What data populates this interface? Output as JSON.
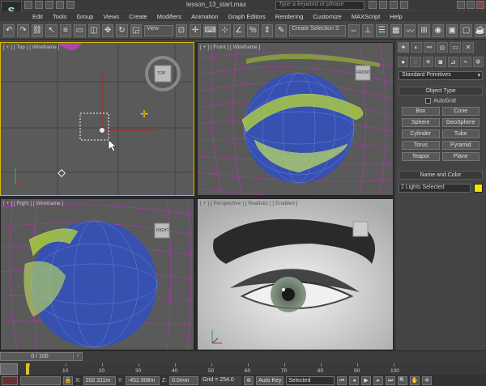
{
  "app": {
    "logo_glyph": "S",
    "document_title": "lesson_13_start.max",
    "search_placeholder": "Type a keyword or phrase"
  },
  "menu": [
    "Edit",
    "Tools",
    "Group",
    "Views",
    "Create",
    "Modifiers",
    "Animation",
    "Graph Editors",
    "Rendering",
    "Customize",
    "MAXScript",
    "Help"
  ],
  "toolbar": {
    "view_select": "View",
    "create_selection_set": "Create Selection S"
  },
  "viewports": {
    "top": {
      "label": "[ + ] [ Top ] [ Wireframe ]",
      "viewcube": "TOP"
    },
    "front": {
      "label": "[ + ] [ Front ] [ Wireframe ]",
      "viewcube": "FRONT"
    },
    "right": {
      "label": "[ + ] [ Right ] [ Wireframe ]",
      "viewcube": "RIGHT"
    },
    "perspective": {
      "label": "[ + ] [ Perspective ] [ Realistic ] [ Enabled ]"
    }
  },
  "command_panel": {
    "category": "Standard Primitives",
    "object_type_header": "Object Type",
    "autogrid": "AutoGrid",
    "objects": [
      "Box",
      "Cone",
      "Sphere",
      "GeoSphere",
      "Cylinder",
      "Tube",
      "Torus",
      "Pyramid",
      "Teapot",
      "Plane"
    ],
    "name_color_header": "Name and Color",
    "name_value": "2 Lights Selected",
    "color": "#f2e600"
  },
  "timeline": {
    "slider": "0 / 100",
    "ticks": [
      "0",
      "10",
      "20",
      "30",
      "40",
      "50",
      "60",
      "70",
      "80",
      "90",
      "100"
    ]
  },
  "status": {
    "x_label": "X:",
    "x_value": "202.311m",
    "y_label": "Y:",
    "y_value": "-452.908m",
    "z_label": "Z:",
    "z_value": "0.0mm",
    "grid": "Grid = 254.0",
    "autokey": "Auto Key",
    "selected": "Selected"
  }
}
